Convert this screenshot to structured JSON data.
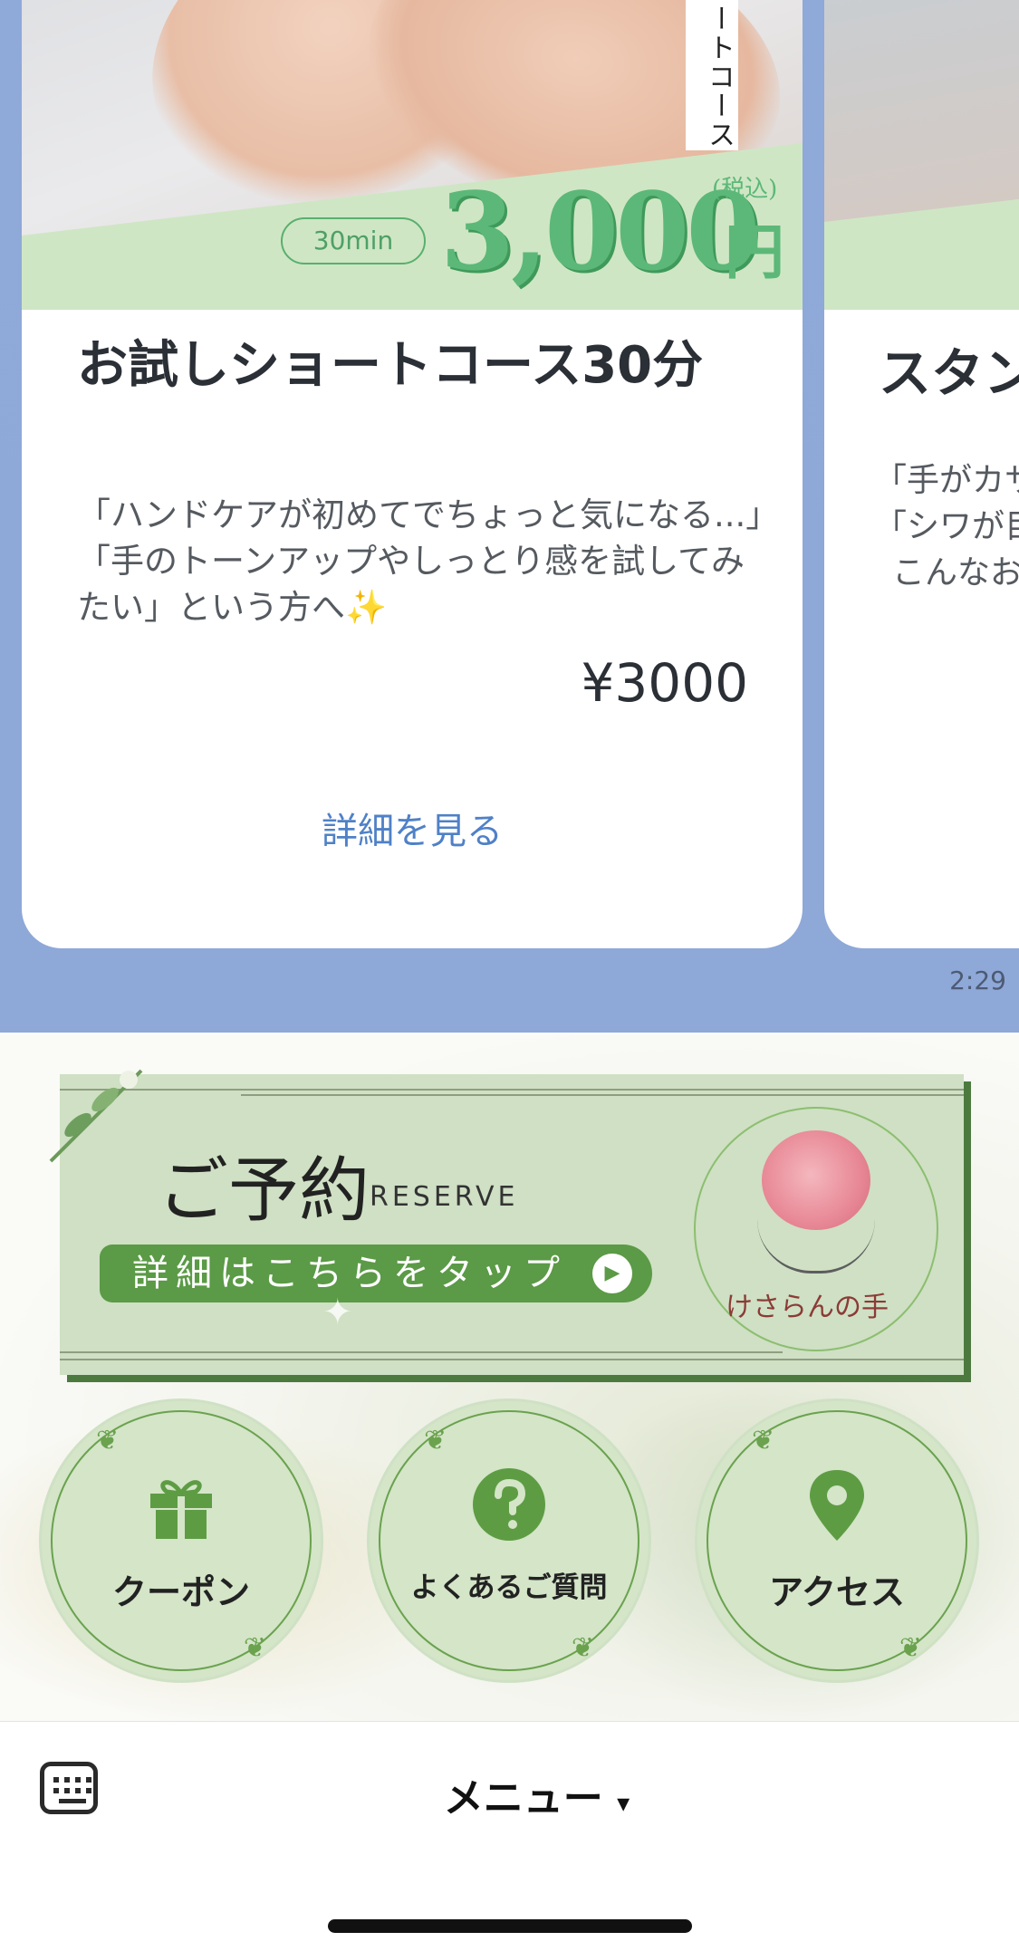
{
  "chat": {
    "cards": [
      {
        "image_vertical_label": "ートコース",
        "duration_pill": "30min",
        "big_price": "3,000",
        "price_unit": "円",
        "tax_note": "(税込)",
        "title": "お試しショートコース30分",
        "description": "「ハンドケアが初めてでちょっと気になる...」「手のトーンアップやしっとり感を試してみたい」という方へ✨",
        "price": "¥3000",
        "link": "詳細を見る"
      },
      {
        "title": "スタン",
        "description_lines": [
          "「手がカサ",
          "「シワが目",
          "こんなお"
        ]
      }
    ],
    "time": "2:29"
  },
  "richmenu": {
    "reserve": {
      "title": "ご予約",
      "subtitle": "RESERVE",
      "button": "詳細はこちらをタップ",
      "brand": "けさらんの手"
    },
    "buttons": [
      {
        "label": "クーポン",
        "icon": "gift-icon"
      },
      {
        "label": "よくあるご質問",
        "icon": "question-icon"
      },
      {
        "label": "アクセス",
        "icon": "map-pin-icon"
      }
    ],
    "accent_color": "#5b9a46"
  },
  "bottombar": {
    "menu_label": "メニュー",
    "menu_caret": "▾"
  }
}
